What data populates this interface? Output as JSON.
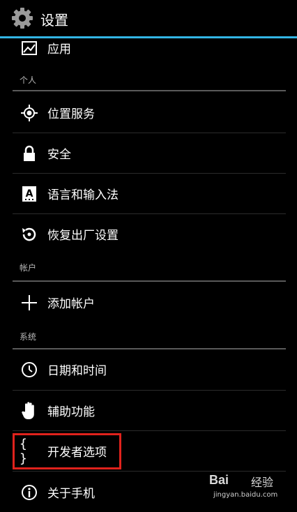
{
  "header": {
    "title": "设置",
    "icon": "settings-gear-icon"
  },
  "sections": {
    "personal": "个人",
    "accounts": "帐户",
    "system": "系统"
  },
  "items": {
    "apps": {
      "label": "应用",
      "icon": "apps-icon"
    },
    "location": {
      "label": "位置服务",
      "icon": "location-icon"
    },
    "security": {
      "label": "安全",
      "icon": "lock-icon"
    },
    "language": {
      "label": "语言和输入法",
      "icon": "keyboard-a-icon"
    },
    "reset": {
      "label": "恢复出厂设置",
      "icon": "restore-icon"
    },
    "add_account": {
      "label": "添加帐户",
      "icon": "plus-icon"
    },
    "datetime": {
      "label": "日期和时间",
      "icon": "clock-icon"
    },
    "accessibility": {
      "label": "辅助功能",
      "icon": "hand-icon"
    },
    "developer": {
      "label": "开发者选项",
      "icon": "braces-icon",
      "icon_text": "{ }"
    },
    "about": {
      "label": "关于手机",
      "icon": "info-icon"
    }
  },
  "highlight_color": "#e0221c",
  "accent_color": "#33b5e5",
  "watermark": {
    "logo": "Bai",
    "text": "经验",
    "url": "jingyan.baidu.com"
  }
}
